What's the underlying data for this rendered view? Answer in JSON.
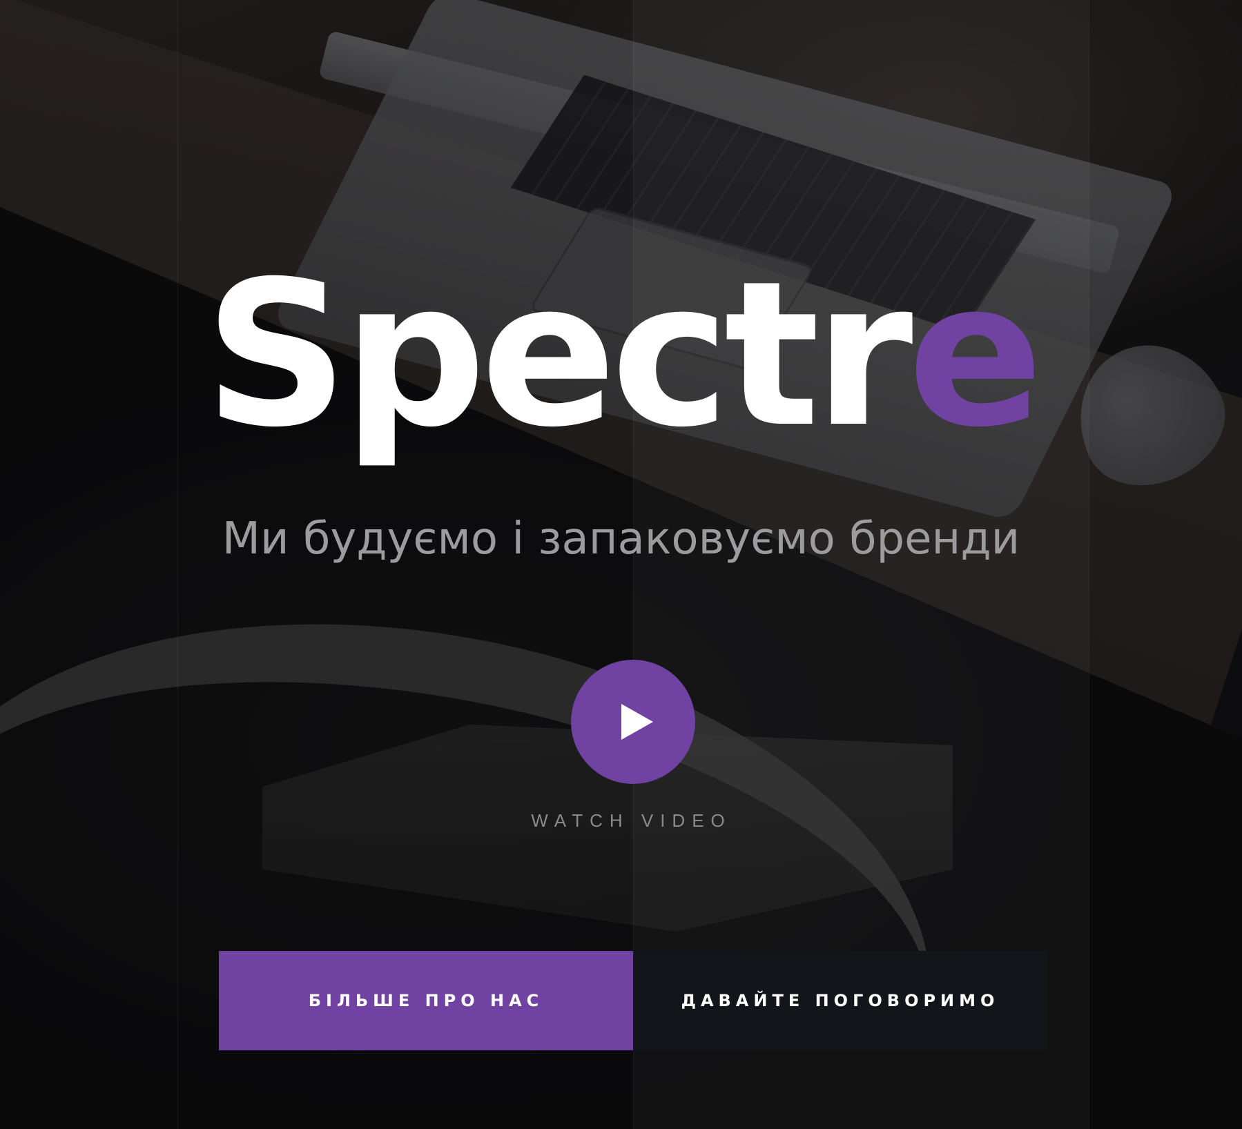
{
  "hero": {
    "title_main": "Spectr",
    "title_accent": "e",
    "subtitle": "Ми будуємо і запаковуємо бренди",
    "play_icon": "play-icon",
    "watch_video": "WATCH VIDEO"
  },
  "buttons": {
    "primary_label": "БІЛЬШЕ ПРО НАС",
    "secondary_label": "ДАВАЙТЕ ПОГОВОРИМО"
  },
  "colors": {
    "accent": "#7042a2",
    "dark_button": "#14151a",
    "text": "#ffffff",
    "subtitle": "#9c9c9e"
  }
}
